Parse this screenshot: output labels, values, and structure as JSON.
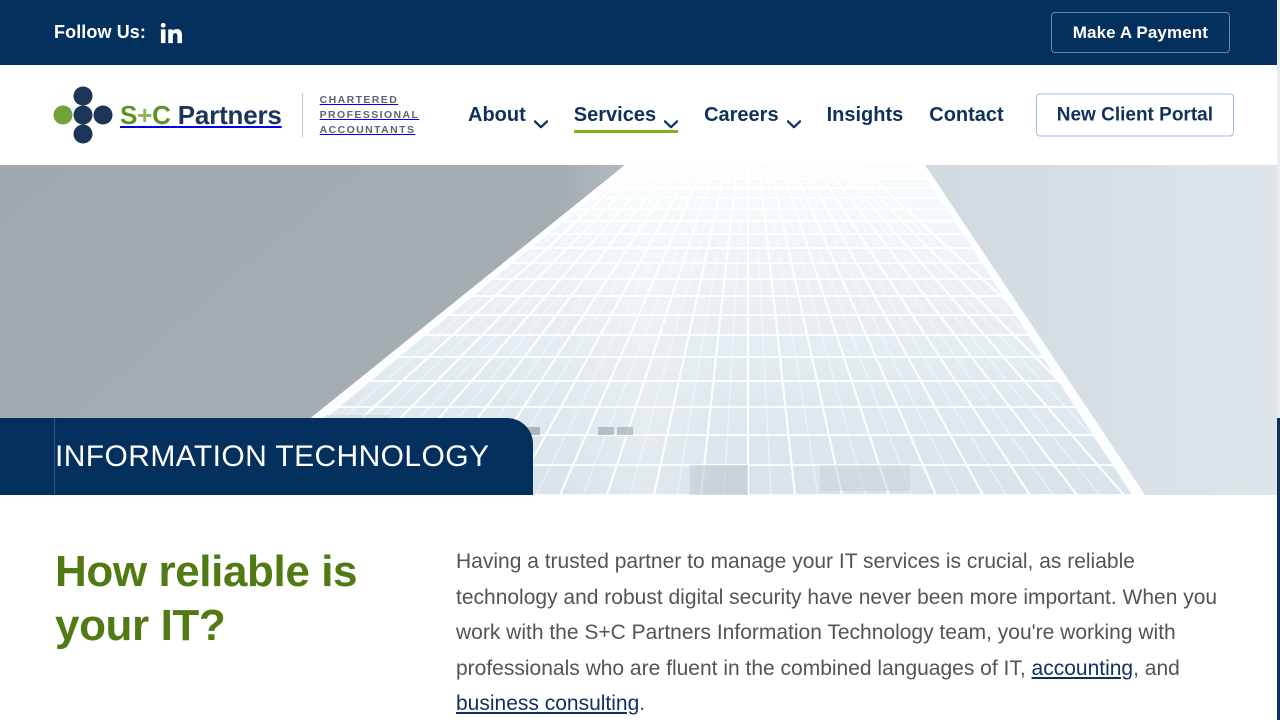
{
  "topbar": {
    "follow_label": "Follow Us:",
    "social_icon": "linkedin-icon",
    "payment_button": "Make A Payment",
    "bg_color": "#04305e"
  },
  "header": {
    "logo": {
      "icon": "five-dot-cross-logo-icon",
      "word_s_c": "S",
      "word_plus": "+",
      "word_c": "C",
      "word_partners": "Partners",
      "full_text": "S+C Partners",
      "tagline_line1": "CHARTERED",
      "tagline_line2": "PROFESSIONAL",
      "tagline_line3": "ACCOUNTANTS",
      "green": "#5f9220",
      "navy": "#1d3557"
    },
    "nav": [
      {
        "label": "About",
        "has_dropdown": true,
        "active": false
      },
      {
        "label": "Services",
        "has_dropdown": true,
        "active": true
      },
      {
        "label": "Careers",
        "has_dropdown": true,
        "active": false
      },
      {
        "label": "Insights",
        "has_dropdown": false,
        "active": false
      },
      {
        "label": "Contact",
        "has_dropdown": false,
        "active": false
      }
    ],
    "portal_button": "New Client Portal",
    "active_accent": "#7ab317"
  },
  "hero": {
    "image_alt": "skyscraper-glass-facade-looking-up",
    "banner_title": "INFORMATION TECHNOLOGY",
    "banner_bg": "#04305e"
  },
  "content": {
    "heading": "How reliable is your IT?",
    "paragraph_part1": "Having a trusted partner to manage your IT services is crucial, as reliable technology and robust digital security have never been more important. When you work with the S+C Partners Information Technology team, you're working with professionals who are fluent in the combined languages of IT, ",
    "link1": "accounting",
    "paragraph_part2": ", and ",
    "link2": "business consulting",
    "paragraph_part3": ".",
    "heading_color": "#527a12",
    "link_color": "#10315c"
  }
}
